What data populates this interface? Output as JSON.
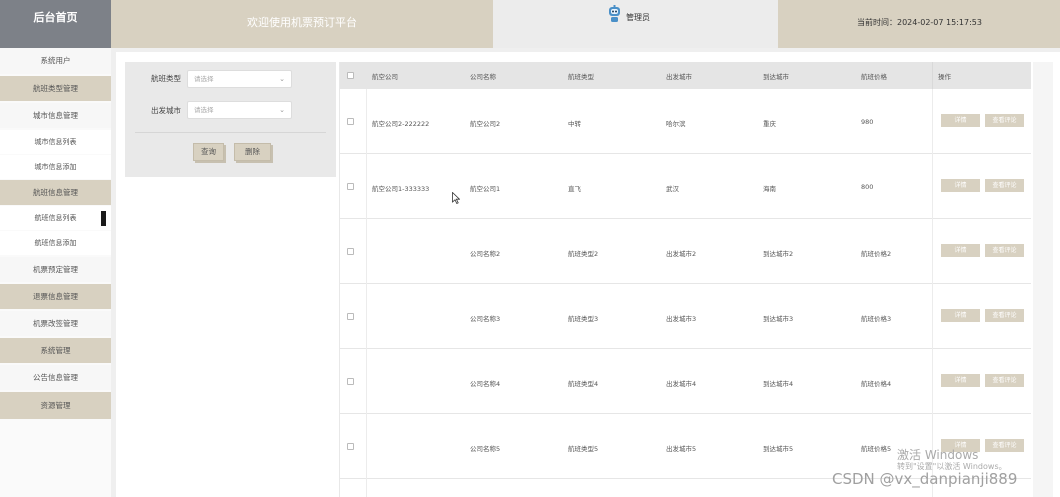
{
  "header": {
    "logo": "后台首页",
    "welcome": "欢迎使用机票预订平台",
    "admin_label": "管理员",
    "time_text": "当前时间：2024-02-07 15:17:53"
  },
  "sidebar": {
    "items": [
      {
        "label": "系统用户"
      },
      {
        "label": "航班类型管理"
      },
      {
        "label": "城市信息管理"
      },
      {
        "label": "城市信息列表"
      },
      {
        "label": "城市信息添加"
      },
      {
        "label": "航班信息管理"
      },
      {
        "label": "航班信息列表"
      },
      {
        "label": "航班信息添加"
      },
      {
        "label": "机票预定管理"
      },
      {
        "label": "退票信息管理"
      },
      {
        "label": "机票改签管理"
      },
      {
        "label": "系统管理"
      },
      {
        "label": "公告信息管理"
      },
      {
        "label": "资源管理"
      }
    ]
  },
  "filter": {
    "flight_type_label": "航班类型",
    "flight_type_placeholder": "请选择",
    "city_label": "出发城市",
    "city_placeholder": "请选择",
    "query_label": "查询",
    "delete_label": "删除"
  },
  "table": {
    "headers": [
      "航空公司",
      "公司名称",
      "航班类型",
      "出发城市",
      "到达城市",
      "航班价格",
      "操作"
    ],
    "rows": [
      {
        "airline": "航空公司2-222222",
        "company": "航空公司2",
        "type": "中转",
        "from": "哈尔滨",
        "to": "重庆",
        "price": "980"
      },
      {
        "airline": "航空公司1-333333",
        "company": "航空公司1",
        "type": "直飞",
        "from": "武汉",
        "to": "海南",
        "price": "800"
      },
      {
        "airline": "",
        "company": "公司名称2",
        "type": "航班类型2",
        "from": "出发城市2",
        "to": "到达城市2",
        "price": "航班价格2"
      },
      {
        "airline": "",
        "company": "公司名称3",
        "type": "航班类型3",
        "from": "出发城市3",
        "to": "到达城市3",
        "price": "航班价格3"
      },
      {
        "airline": "",
        "company": "公司名称4",
        "type": "航班类型4",
        "from": "出发城市4",
        "to": "到达城市4",
        "price": "航班价格4"
      },
      {
        "airline": "",
        "company": "公司名称5",
        "type": "航班类型5",
        "from": "出发城市5",
        "to": "到达城市5",
        "price": "航班价格5"
      }
    ],
    "detail_label": "详情",
    "review_label": "查看评论"
  },
  "watermark": {
    "activate_title": "激活 Windows",
    "activate_sub": "转到\"设置\"以激活 Windows。",
    "csdn": "CSDN @vx_danpianji889"
  },
  "colors": {
    "beige": "#d8d1c1",
    "gray_logo": "#7d8188"
  }
}
